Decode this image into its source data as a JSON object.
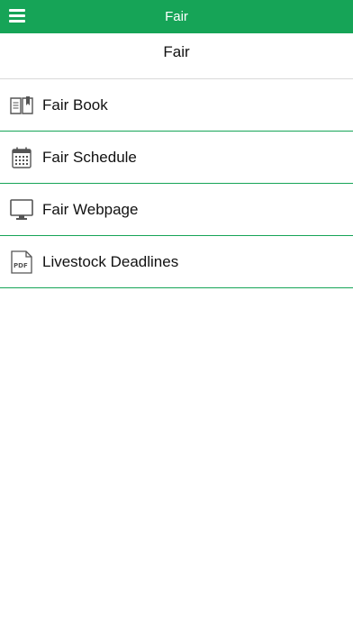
{
  "topbar": {
    "title": "Fair",
    "menu_icon": "hamburger-menu-icon"
  },
  "page": {
    "title": "Fair"
  },
  "items": [
    {
      "label": "Fair Book",
      "icon": "book-icon"
    },
    {
      "label": "Fair Schedule",
      "icon": "calendar-icon"
    },
    {
      "label": "Fair Webpage",
      "icon": "monitor-icon"
    },
    {
      "label": "Livestock Deadlines",
      "icon": "pdf-file-icon"
    }
  ],
  "colors": {
    "accent": "#16a457",
    "icon": "#555555",
    "text": "#111111"
  }
}
